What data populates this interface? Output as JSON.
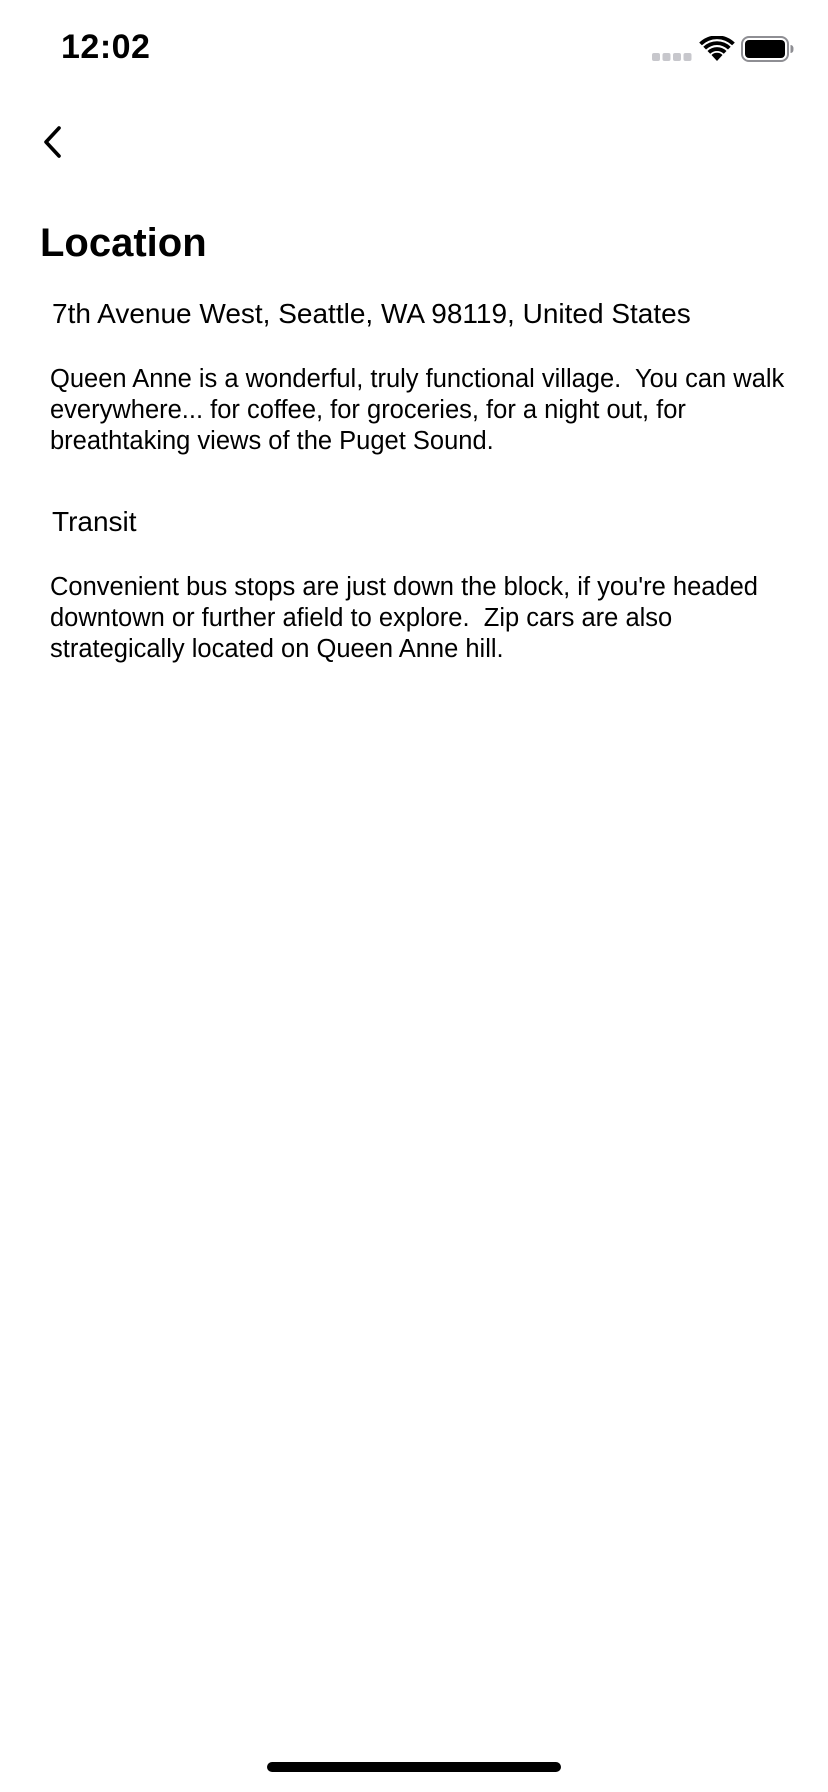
{
  "status_bar": {
    "time": "12:02",
    "icons": [
      "signal-icon",
      "wifi-icon",
      "battery-icon"
    ]
  },
  "navigation": {
    "back_icon": "chevron-left-icon"
  },
  "page": {
    "title": "Location",
    "address": "7th Avenue West, Seattle, WA 98119, United States",
    "description": "Queen Anne is a wonderful, truly functional village.  You can walk everywhere... for coffee, for groceries, for a night out, for breathtaking views of the Puget Sound.",
    "transit": {
      "heading": "Transit",
      "description": "Convenient bus stops are just down the block, if you're headed downtown or further afield to explore.  Zip cars are also strategically located on Queen Anne hill."
    }
  }
}
